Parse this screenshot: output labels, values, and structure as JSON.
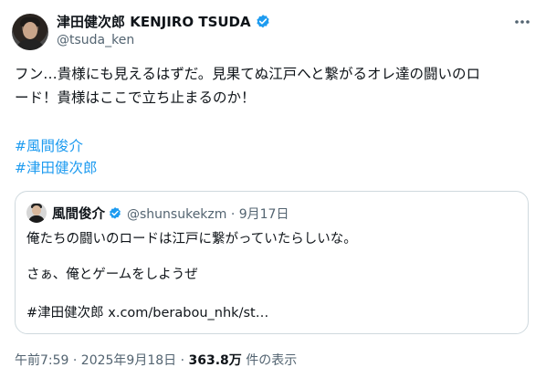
{
  "author": {
    "display_name": "津田健次郎 KENJIRO TSUDA",
    "handle": "@tsuda_ken"
  },
  "tweet": {
    "text_line1": "フン…貴様にも見えるはずだ。見果てぬ江戸へと繋がるオレ達の闘いのロ",
    "text_line2": "ード！貴様はここで立ち止まるのか！",
    "hashtags": [
      "#風間俊介",
      "#津田健次郎"
    ]
  },
  "quote": {
    "display_name": "風間俊介",
    "meta": "@shunsukekzm · 9月17日",
    "line1": "俺たちの闘いのロードは江戸に繋がっていたらしいな。",
    "line2": "さぁ、俺とゲームをしようぜ",
    "line3": "#津田健次郎 x.com/berabou_nhk/st…"
  },
  "footer": {
    "timestamp": "午前7:59 · 2025年9月18日 · ",
    "views_count": "363.8万",
    "views_label": " 件の表示"
  },
  "colors": {
    "accent": "#1d9bf0",
    "text": "#0f1419",
    "secondary": "#536471",
    "border": "#cfd9de"
  },
  "icons": {
    "verified": "verified-badge-icon",
    "more": "more-options-icon"
  }
}
